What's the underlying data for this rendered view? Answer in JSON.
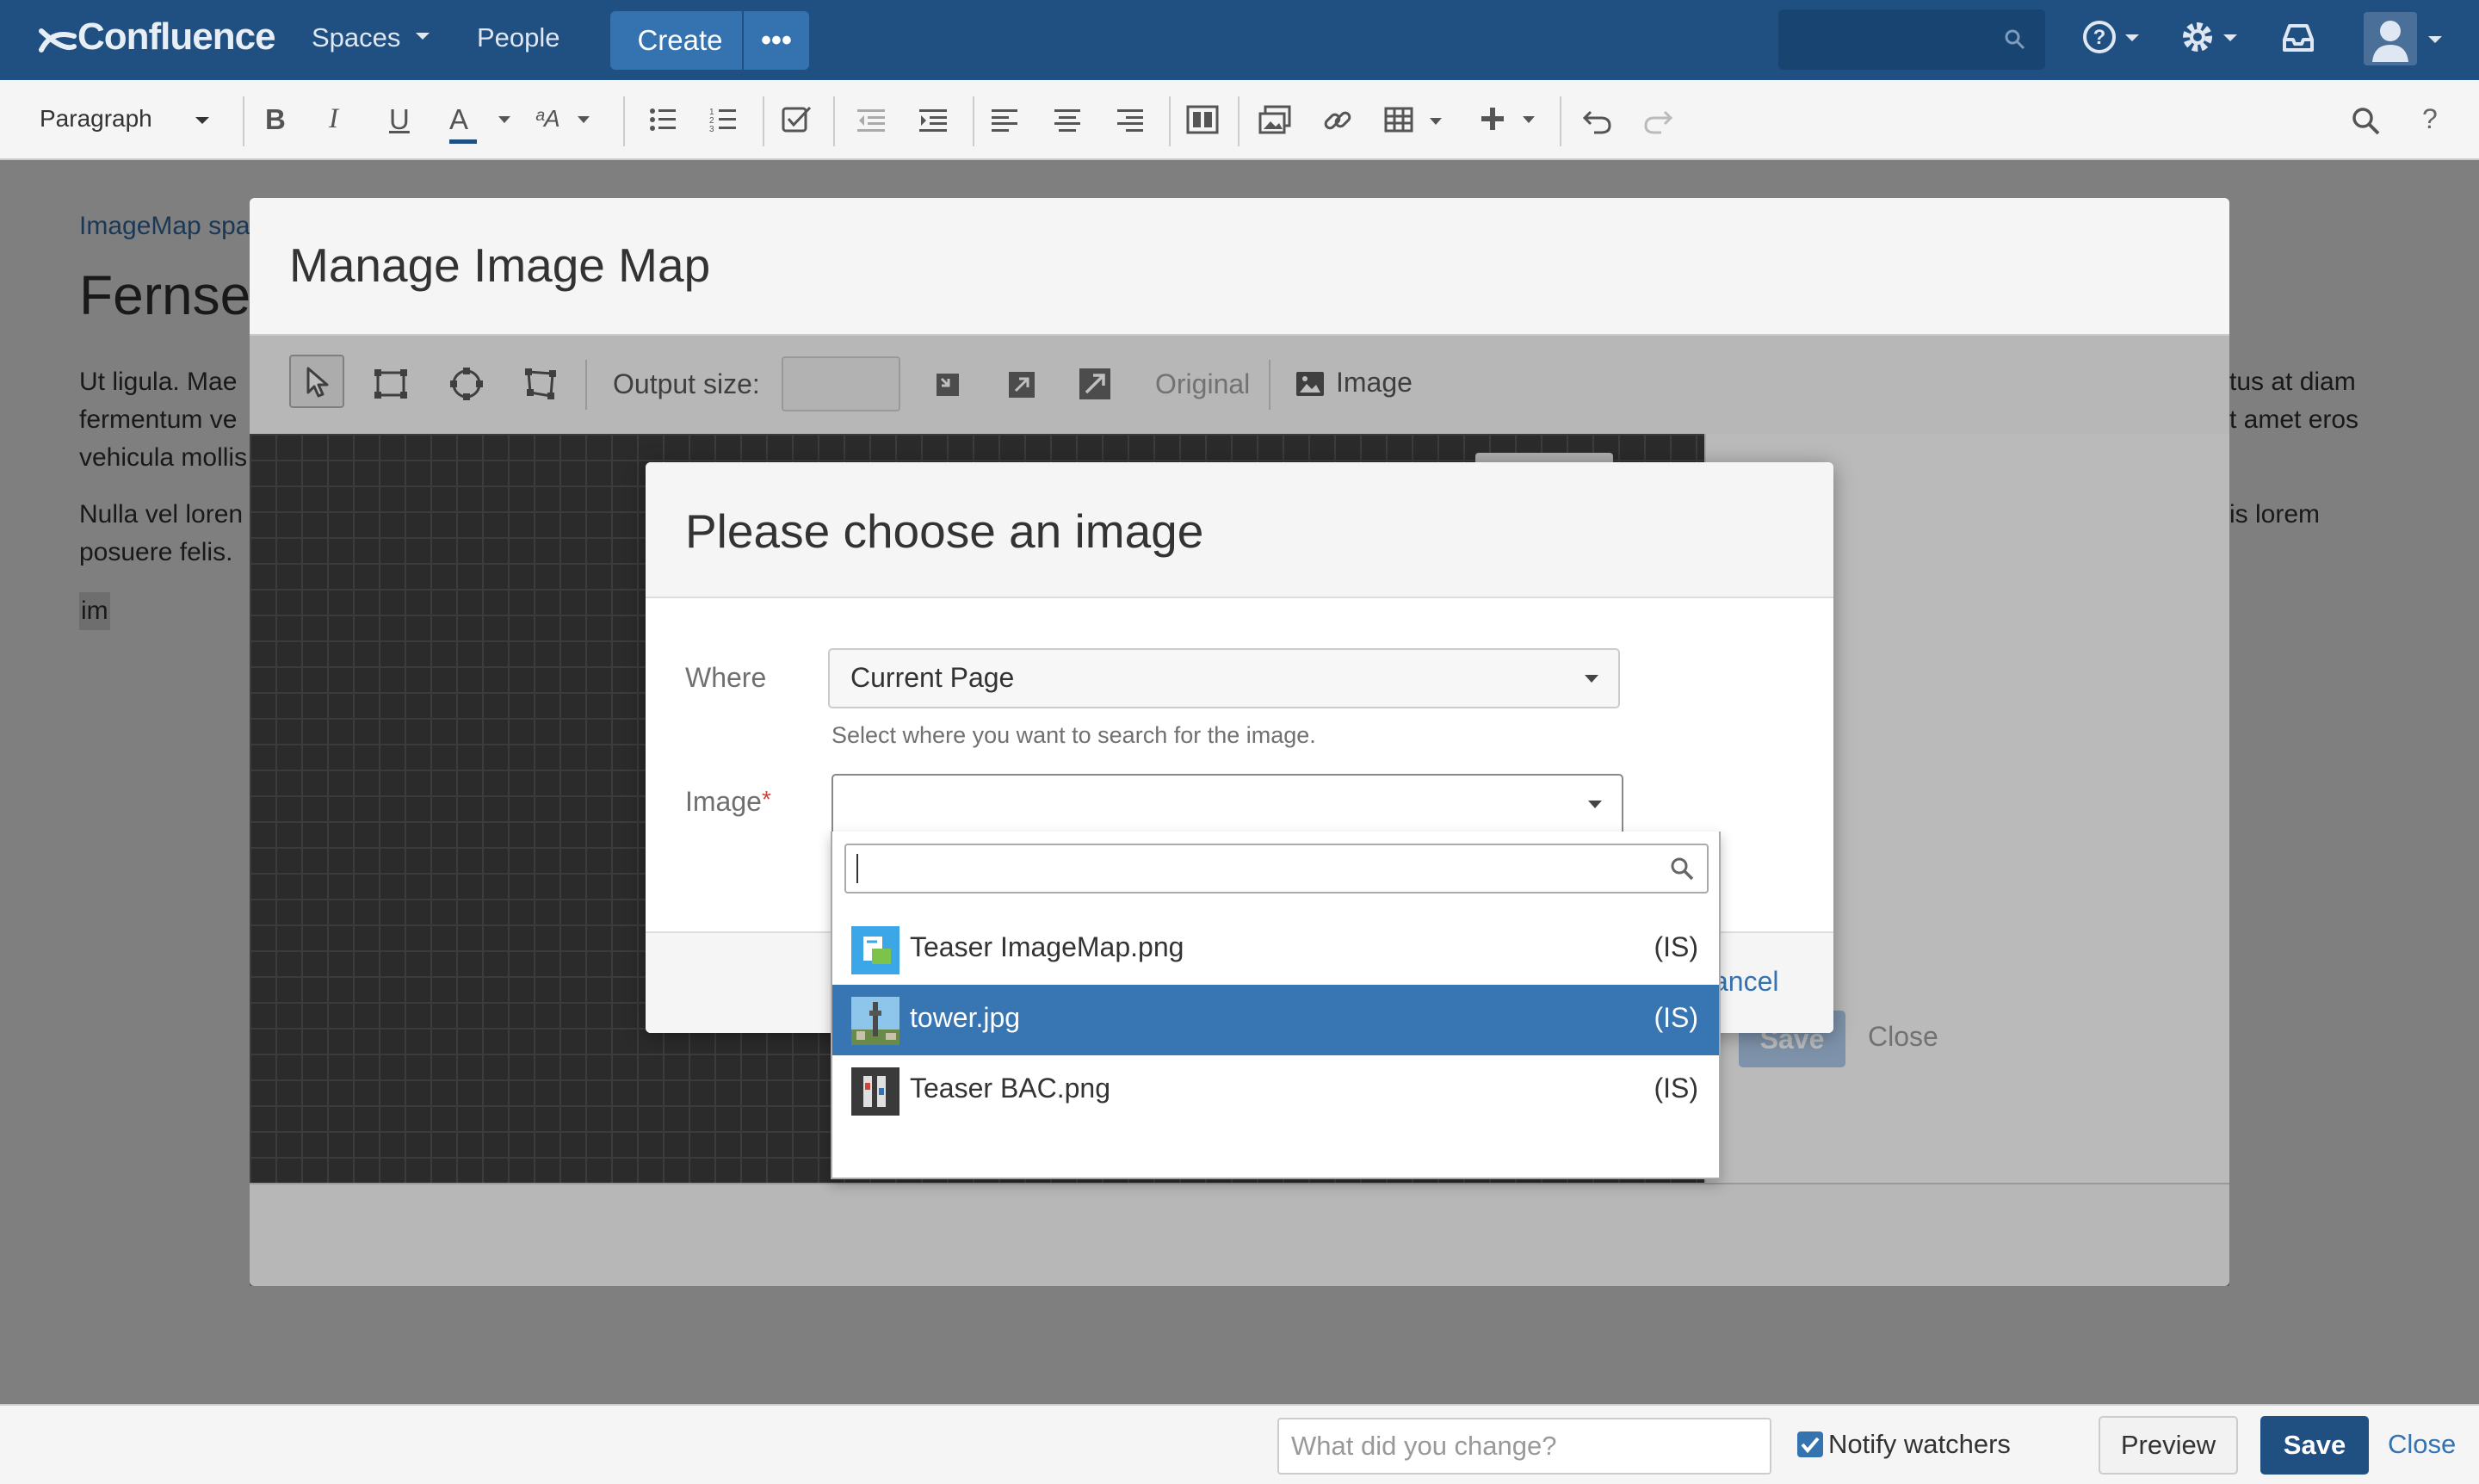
{
  "nav": {
    "logo": "Confluence",
    "spaces": "Spaces",
    "people": "People",
    "create": "Create",
    "more": "•••"
  },
  "toolbar": {
    "paragraph": "Paragraph"
  },
  "page": {
    "breadcrumb": "ImageMap spa",
    "title": "Fernse",
    "para1_line1": "Ut ligula. Mae",
    "para1_line2": "fermentum ve",
    "para1_line3": "vehicula mollis",
    "para1_right1": "tus at diam",
    "para1_right2": "t amet eros",
    "para2_line1": "Nulla vel loren",
    "para2_line2": "posuere felis.",
    "para2_right1": "is lorem",
    "macro": "im"
  },
  "outer_dialog": {
    "title": "Manage Image Map",
    "output_size_label": "Output size:",
    "output_size_value": "",
    "original_label": "Original",
    "image_label": "Image",
    "save": "Save",
    "close": "Close"
  },
  "inner_dialog": {
    "title": "Please choose an image",
    "where_label": "Where",
    "where_value": "Current Page",
    "where_hint": "Select where you want to search for the image.",
    "image_label": "Image",
    "required_mark": "*",
    "cancel_partial": "ancel"
  },
  "dropdown": {
    "search_value": "",
    "items": [
      {
        "name": "Teaser ImageMap.png",
        "tag": "(IS)",
        "selected": false
      },
      {
        "name": "tower.jpg",
        "tag": "(IS)",
        "selected": true
      },
      {
        "name": "Teaser BAC.png",
        "tag": "(IS)",
        "selected": false
      }
    ]
  },
  "bottombar": {
    "comment_placeholder": "What did you change?",
    "notify_label": "Notify watchers",
    "preview": "Preview",
    "save": "Save",
    "close": "Close"
  },
  "colors": {
    "nav_bg": "#205081",
    "accent": "#3572b0",
    "selection": "#3875b3"
  }
}
